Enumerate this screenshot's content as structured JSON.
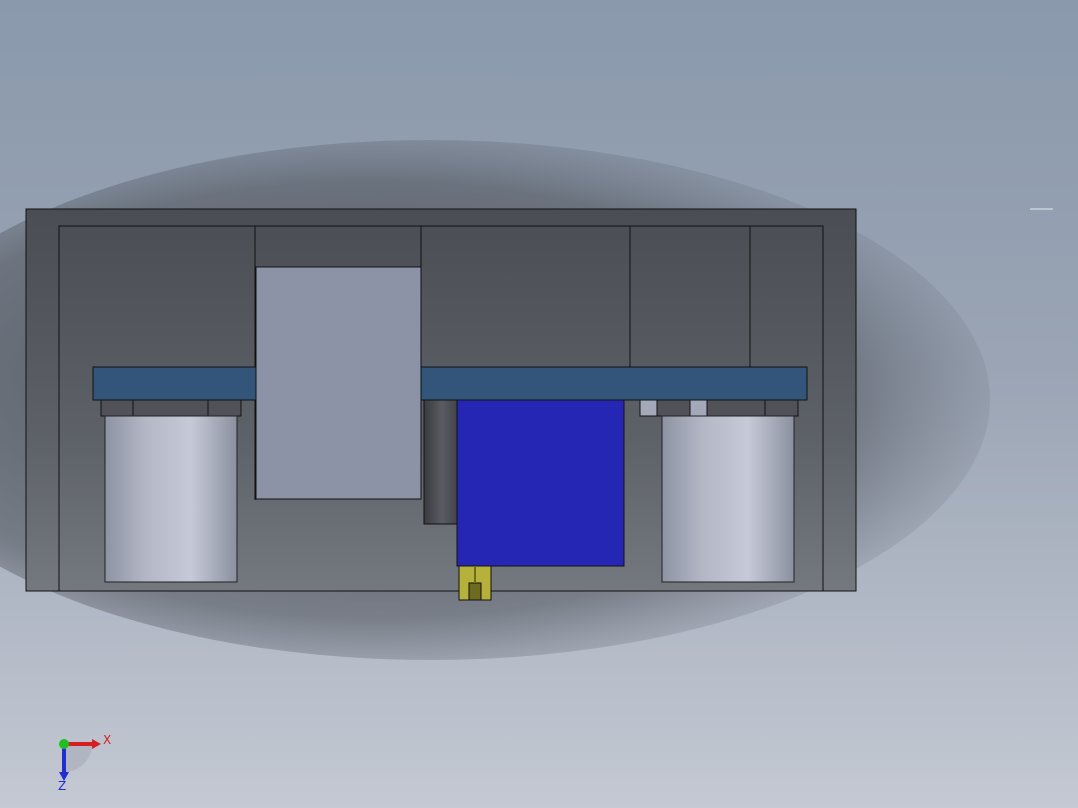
{
  "viewport": {
    "background_top": "#8a99ac",
    "background_bottom": "#c4c9d3"
  },
  "model": {
    "frame_color": "#5c6066",
    "plate_color": "#34557a",
    "motor_color": "#2626b5",
    "block_color": "#8d93a6",
    "cylinder_color": "#aab0c2",
    "fitting_color": "#b5b13a",
    "edge_color": "#111111"
  },
  "triad": {
    "x_label": "X",
    "z_label": "Z",
    "x_color": "#d42020",
    "y_color": "#20c020",
    "z_color": "#2030d0"
  }
}
